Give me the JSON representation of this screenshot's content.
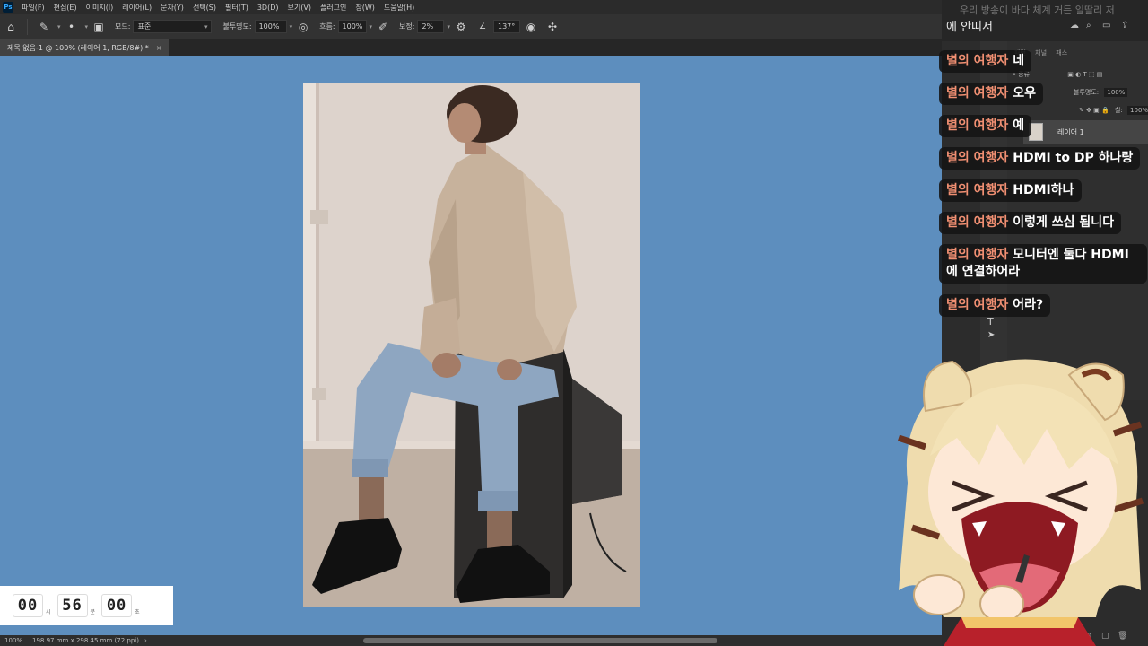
{
  "app": {
    "logo_text": "Ps",
    "menu": [
      "파일(F)",
      "편집(E)",
      "이미지(I)",
      "레이어(L)",
      "문자(Y)",
      "선택(S)",
      "필터(T)",
      "3D(D)",
      "보기(V)",
      "플러그인",
      "창(W)",
      "도움말(H)"
    ]
  },
  "options_bar": {
    "mode_label": "모드:",
    "mode_value": "표준",
    "opacity_label": "불투명도:",
    "opacity_value": "100%",
    "flow_label": "흐름:",
    "flow_value": "100%",
    "smoothing_label": "보정:",
    "smoothing_value": "2%",
    "angle_value": "137°"
  },
  "document": {
    "tab_title": "제목 없음-1 @ 100% (레이어 1, RGB/8#) *",
    "tab_close": "×"
  },
  "status_bar": {
    "zoom": "100%",
    "doc_size": "198.97 mm x 298.45 mm (72 ppi)",
    "arrow": "›"
  },
  "timer": {
    "hours": "00",
    "hours_unit": "시",
    "minutes": "56",
    "minutes_unit": "분",
    "seconds": "00",
    "seconds_unit": "초"
  },
  "right_panel": {
    "header_text": "에 안띠서",
    "ghost_text": "우리 방송이 바다 체계 거든 일딸리 저",
    "tabs": [
      "패턴",
      "채널",
      "패스"
    ],
    "kind_label": "종류",
    "opacity_label": "불투명도:",
    "opacity_value": "100%",
    "fill_label": "칠:",
    "fill_value": "100%",
    "layer_name": "레이어 1"
  },
  "chat": {
    "messages": [
      {
        "user": "별의 여행자",
        "text": "네"
      },
      {
        "user": "별의 여행자",
        "text": "오우"
      },
      {
        "user": "별의 여행자",
        "text": "예"
      },
      {
        "user": "별의 여행자",
        "text": "HDMI to DP 하나랑"
      },
      {
        "user": "별의 여행자",
        "text": "HDMI하나"
      },
      {
        "user": "별의 여행자",
        "text": "이렇게 쓰심 됩니다"
      },
      {
        "user": "별의 여행자",
        "text": "모니터엔 둘다 HDMI에 연결하어라"
      },
      {
        "user": "별의 여행자",
        "text": "어라?"
      }
    ]
  },
  "colors": {
    "canvas_bg": "#5d8ebe",
    "chat_username": "#f08f72",
    "ui_dark": "#2b2b2b"
  }
}
